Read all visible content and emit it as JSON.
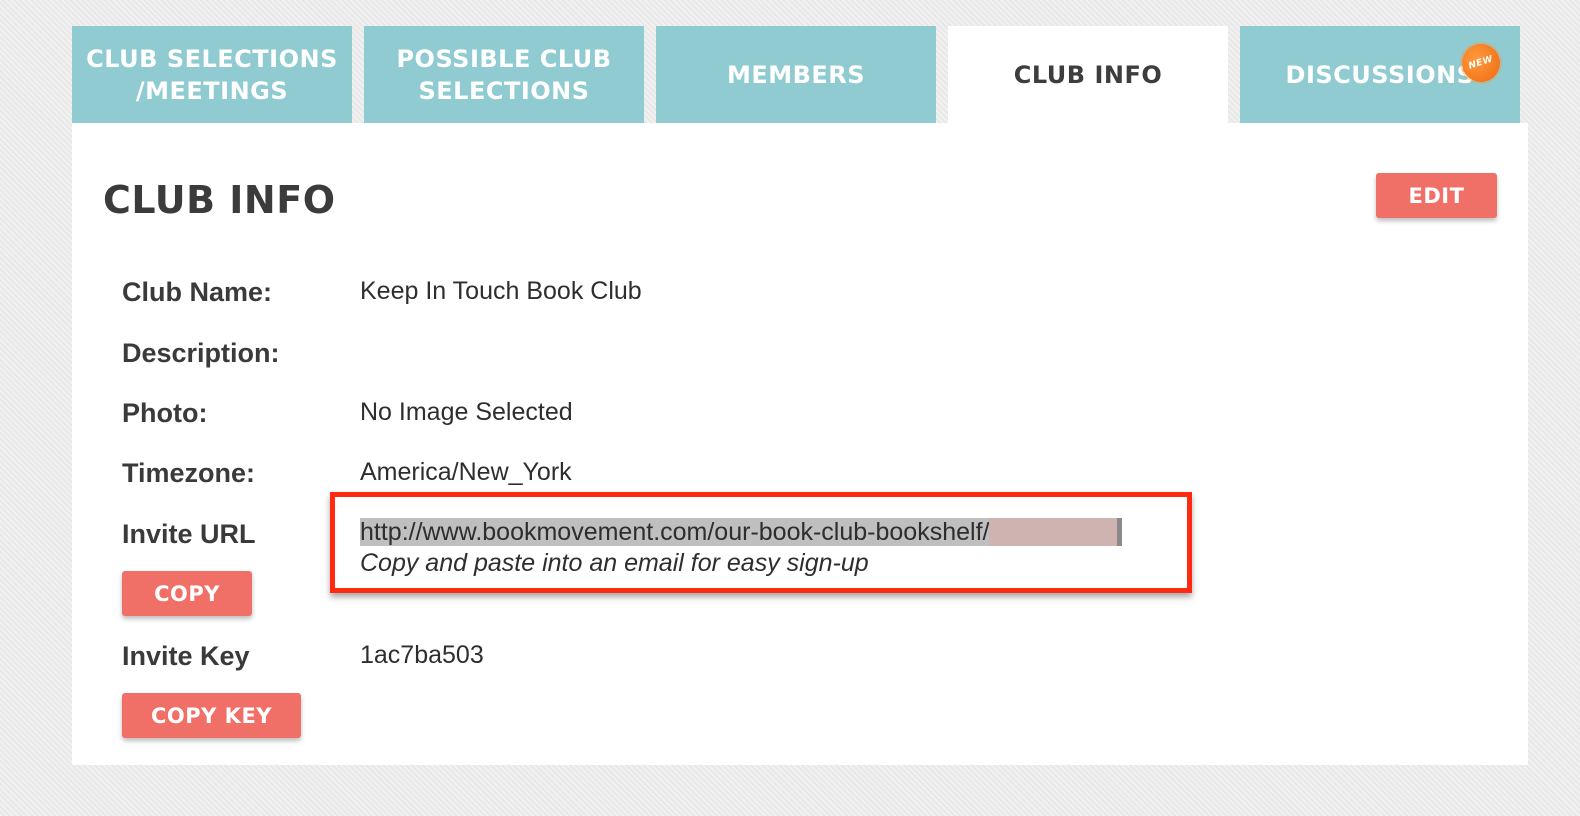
{
  "tabs": [
    {
      "label": "CLUB SELECTIONS\n/MEETINGS"
    },
    {
      "label": "POSSIBLE CLUB\nSELECTIONS"
    },
    {
      "label": "MEMBERS"
    },
    {
      "label": "CLUB INFO",
      "active": true
    },
    {
      "label": "DISCUSSIONS",
      "badge": "NEW"
    }
  ],
  "panel": {
    "title": "CLUB INFO",
    "edit_label": "EDIT",
    "fields": {
      "club_name": {
        "label": "Club Name:",
        "value": "Keep In Touch Book Club"
      },
      "description": {
        "label": "Description:",
        "value": ""
      },
      "photo": {
        "label": "Photo:",
        "value": "No Image Selected"
      },
      "timezone": {
        "label": "Timezone:",
        "value": "America/New_York"
      },
      "invite_url": {
        "label": "Invite URL",
        "value": "http://www.bookmovement.com/our-book-club-bookshelf/",
        "hint": "Copy and paste into an email for easy sign-up",
        "copy_label": "COPY"
      },
      "invite_key": {
        "label": "Invite Key",
        "value": "1ac7ba503",
        "copy_label": "COPY KEY"
      }
    }
  },
  "colors": {
    "tab_bg": "#8fcbd0",
    "button_bg": "#f07068",
    "highlight_border": "#ff2a10",
    "badge": "#ee6a10"
  }
}
